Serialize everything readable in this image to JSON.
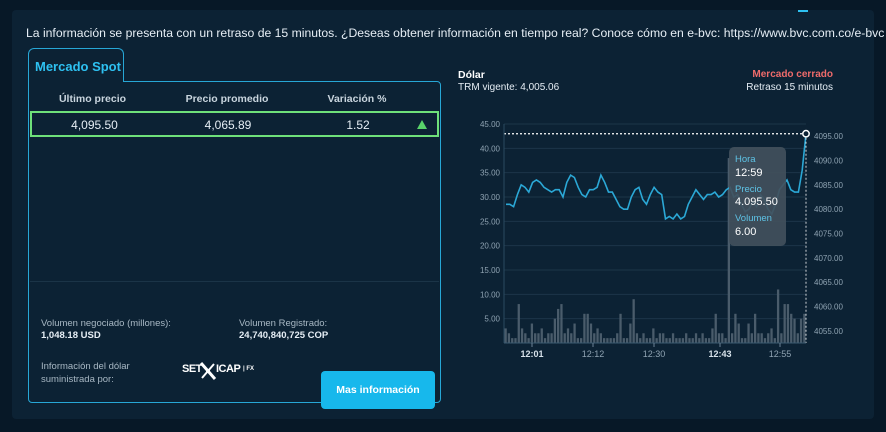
{
  "notice": "La información se presenta con un retraso de 15 minutos. ¿Deseas obtener información en tiempo real? Conoce cómo en e-bvc: https://www.bvc.com.co/e-bvc",
  "left": {
    "tab": "Mercado Spot",
    "headers": {
      "last": "Último precio",
      "avg": "Precio promedio",
      "var": "Variación %"
    },
    "row": {
      "last": "4,095.50",
      "avg": "4,065.89",
      "var": "1.52",
      "trend_color": "#59d36a"
    },
    "volume_label": "Volumen negociado (millones):",
    "volume_value": "1,048.18 USD",
    "registered_label": "Volumen Registrado:",
    "registered_value": "24,740,840,725 COP",
    "source_label_1": "Información del dólar",
    "source_label_2": "suministrada por:",
    "logo": {
      "part1": "SET",
      "part2": "ICAP",
      "part3": "| FX"
    },
    "button": "Mas información"
  },
  "right": {
    "title": "Dólar",
    "subtitle": "TRM vigente: 4,005.06",
    "status": "Mercado cerrado",
    "delay": "Retraso 15 minutos",
    "tooltip": {
      "hora_label": "Hora",
      "hora": "12:59",
      "precio_label": "Precio",
      "precio": "4.095.50",
      "volumen_label": "Volumen",
      "volumen": "6.00"
    }
  },
  "chart_data": {
    "type": "line",
    "x_ticks": [
      "12:01",
      "12:12",
      "12:30",
      "12:43",
      "12:55"
    ],
    "x_ticks_bold": [
      true,
      false,
      false,
      true,
      false
    ],
    "y_left_ticks": [
      "45.00",
      "40.00",
      "35.00",
      "30.00",
      "25.00",
      "20.00",
      "15.00",
      "10.00",
      "5.00"
    ],
    "y_right_ticks": [
      "4095.00",
      "4090.00",
      "4085.00",
      "4080.00",
      "4075.00",
      "4070.00",
      "4065.00",
      "4060.00",
      "4055.00"
    ],
    "y_left_range": [
      0,
      45
    ],
    "y_right_range": [
      4052.5,
      4097.5
    ],
    "line_color": "#2ba8d6",
    "bar_color": "#4a5c6b",
    "price": [
      4081,
      4081,
      4080.5,
      4083,
      4085,
      4084.5,
      4083.5,
      4085.5,
      4086,
      4085.5,
      4084.5,
      4084,
      4083.5,
      4084,
      4084,
      4082.5,
      4085.5,
      4087,
      4086.5,
      4084.5,
      4083,
      4082.5,
      4084,
      4084,
      4084.5,
      4087,
      4085.5,
      4083.5,
      4083.5,
      4082,
      4080.5,
      4080,
      4080,
      4082.5,
      4084,
      4084.5,
      4082,
      4081,
      4083,
      4084.5,
      4083.5,
      4083,
      4078,
      4078.5,
      4078,
      4079,
      4078,
      4078.5,
      4081,
      4082.5,
      4084,
      4083,
      4082,
      4083,
      4083,
      4083.5,
      4082.5,
      4083,
      4084,
      4084.5,
      4082.5,
      4083,
      4081,
      4079.5,
      4080,
      4081.5,
      4080.5,
      4083,
      4082,
      4080,
      4079,
      4081,
      4084,
      4085,
      4086,
      4084,
      4083.5,
      4083.5,
      4088,
      4095.5
    ],
    "volume": [
      3,
      2,
      1,
      1,
      8,
      3,
      2,
      1,
      4,
      2,
      2,
      3,
      1,
      2,
      2,
      5,
      7,
      8,
      2,
      3,
      2,
      4,
      1,
      1,
      6,
      6,
      4,
      2,
      3,
      2,
      1,
      1,
      1,
      1,
      2,
      6,
      1,
      1,
      4,
      9,
      2,
      1,
      2,
      1,
      1,
      3,
      1,
      2,
      2,
      1,
      1,
      2,
      1,
      1,
      1,
      2,
      1,
      1,
      2,
      1,
      2,
      1,
      1,
      3,
      6,
      2,
      2,
      1,
      38,
      2,
      6,
      4,
      1,
      1,
      4,
      2,
      6,
      2,
      2,
      1,
      2,
      3,
      1,
      11,
      2,
      8,
      8,
      6,
      5,
      2,
      5,
      6
    ]
  }
}
